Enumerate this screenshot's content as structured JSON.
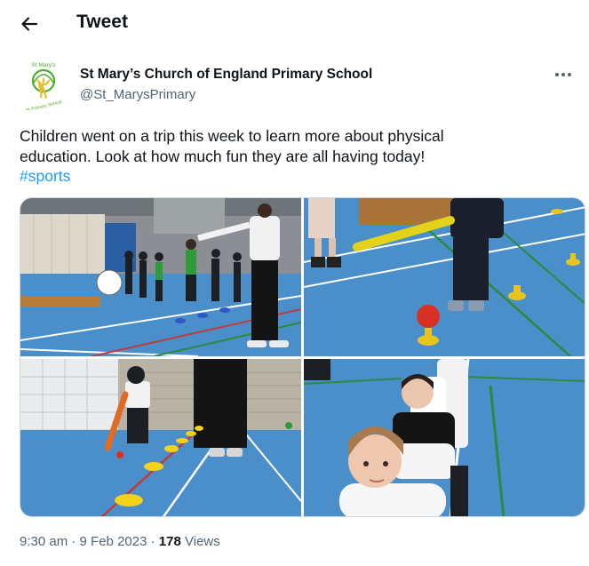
{
  "header": {
    "title": "Tweet",
    "back_icon": "arrow-left-icon"
  },
  "author": {
    "name": "St Mary’s Church of England Primary School",
    "handle": "@St_MarysPrimary",
    "avatar": {
      "arc_top": "St Mary's",
      "arc_bottom": "St Primary School",
      "icon": "tree-logo-icon",
      "color": "#4caf2e"
    }
  },
  "tweet": {
    "text_line1": "Children went on a trip this week to learn more about physical",
    "text_line2": "education. Look at how much fun they are all having today!",
    "hashtag": "#sports"
  },
  "media": {
    "photos": [
      {
        "description": "sports-hall-line-of-children"
      },
      {
        "description": "child-batting-with-yellow-bat"
      },
      {
        "description": "child-batting-between-cones"
      },
      {
        "description": "children-sitting-in-row"
      }
    ]
  },
  "meta": {
    "time": "9:30 am",
    "separator": "·",
    "date": "9 Feb 2023",
    "views_count": "178",
    "views_label": "Views"
  },
  "colors": {
    "link": "#1d9bf0",
    "secondary_text": "#536471",
    "court_blue": "#4a8fc9"
  }
}
